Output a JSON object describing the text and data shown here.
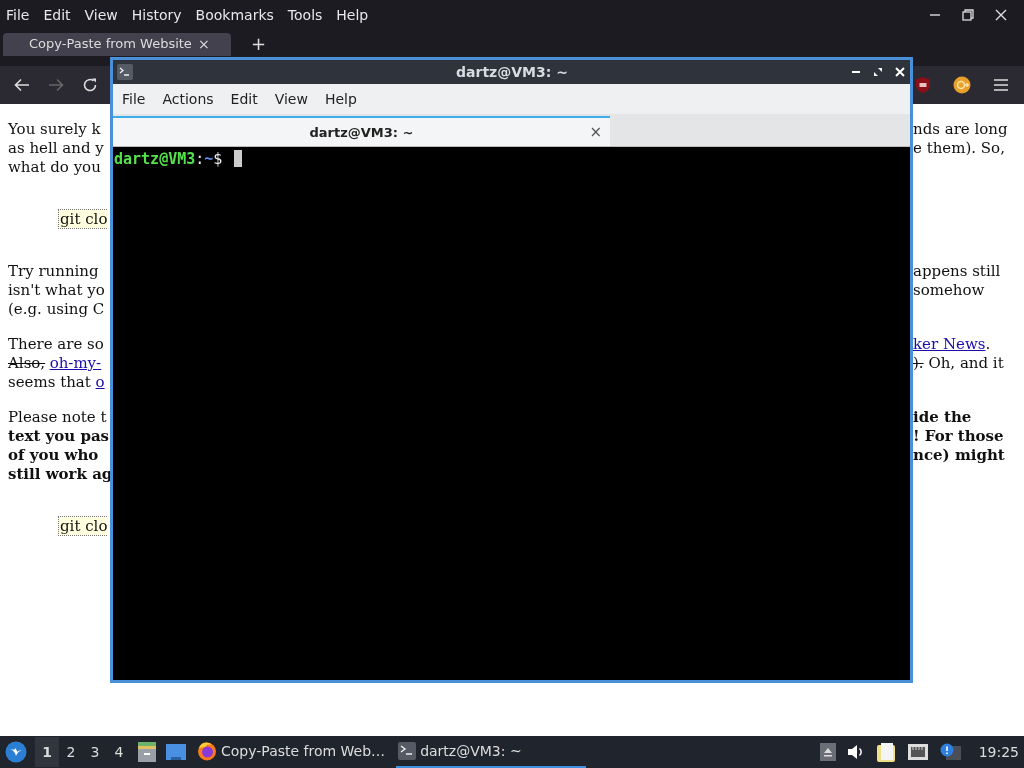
{
  "browser": {
    "menu": [
      "File",
      "Edit",
      "View",
      "History",
      "Bookmarks",
      "Tools",
      "Help"
    ],
    "tabs": [
      {
        "label": "Copy-Paste from Website",
        "selected": true,
        "close": "×"
      }
    ],
    "new_tab": "+",
    "page": [
      {
        "kind": "text",
        "lines": [
          {
            "left": [
              {
                "t": "You surely k",
                "kind": "plain"
              }
            ],
            "right": [
              {
                "t": "nds are long",
                "kind": "plain"
              }
            ]
          },
          {
            "left": [
              {
                "t": "as hell and y",
                "kind": "plain"
              }
            ],
            "right": [
              {
                "t": "e them). So,",
                "kind": "plain"
              }
            ]
          },
          {
            "left": [
              {
                "t": "what do you",
                "kind": "plain"
              }
            ]
          }
        ]
      },
      {
        "kind": "code",
        "text": "git clo"
      },
      {
        "kind": "text",
        "lines": [
          {
            "left": [
              {
                "t": "Try running",
                "kind": "plain"
              }
            ],
            "right": [
              {
                "t": "appens still",
                "kind": "plain"
              }
            ]
          },
          {
            "left": [
              {
                "t": "isn't what yo",
                "kind": "plain"
              }
            ],
            "right": [
              {
                "t": "somehow",
                "kind": "plain"
              }
            ]
          },
          {
            "left": [
              {
                "t": "(e.g. using C",
                "kind": "plain"
              }
            ]
          }
        ]
      },
      {
        "kind": "text",
        "lines": [
          {
            "left": [
              {
                "t": "There are so",
                "kind": "plain"
              }
            ],
            "right": [
              {
                "t": "ker News",
                "kind": "link"
              },
              {
                "t": ".",
                "kind": "plain"
              }
            ]
          },
          {
            "left": [
              {
                "t": "Also,",
                "kind": "strike"
              },
              {
                "t": "oh-my-",
                "kind": "link"
              }
            ],
            "right": [
              {
                "t": ").",
                "kind": "strike"
              },
              {
                "t": " Oh, and it",
                "kind": "plain"
              }
            ]
          },
          {
            "left": [
              {
                "t": "seems that ",
                "kind": "plain"
              },
              {
                "t": "o",
                "kind": "link"
              }
            ]
          }
        ]
      },
      {
        "kind": "text",
        "lines": [
          {
            "left": [
              {
                "t": "Please note t",
                "kind": "plain"
              }
            ],
            "right": [
              {
                "t": "ide the",
                "kind": "bold"
              }
            ]
          },
          {
            "left": [
              {
                "t": "text you pas",
                "kind": "bold"
              }
            ],
            "right": [
              {
                "t": "! For those",
                "kind": "bold"
              }
            ]
          },
          {
            "left": [
              {
                "t": "of you who",
                "kind": "bold"
              }
            ],
            "right": [
              {
                "t": "nce) might",
                "kind": "bold"
              }
            ]
          },
          {
            "left": [
              {
                "t": "still work ag",
                "kind": "bold"
              }
            ]
          }
        ]
      },
      {
        "kind": "code",
        "text": "git clo"
      }
    ]
  },
  "terminal": {
    "title": "dartz@VM3: ~",
    "menu": [
      "File",
      "Actions",
      "Edit",
      "View",
      "Help"
    ],
    "tabs": [
      {
        "label": "dartz@VM3: ~",
        "selected": true,
        "close": "×"
      }
    ],
    "prompt": {
      "user": "dartz@VM3",
      "sep": ":",
      "path": "~",
      "symbol": "$"
    }
  },
  "taskbar": {
    "workspaces": [
      {
        "label": "1",
        "selected": true
      },
      {
        "label": "2",
        "selected": false
      },
      {
        "label": "3",
        "selected": false
      },
      {
        "label": "4",
        "selected": false
      }
    ],
    "tasks": [
      {
        "kind": "firefox",
        "label": "Copy-Paste from Web…",
        "selected": false
      },
      {
        "kind": "terminal",
        "label": "dartz@VM3: ~",
        "selected": true
      }
    ],
    "clock": "19:25"
  }
}
